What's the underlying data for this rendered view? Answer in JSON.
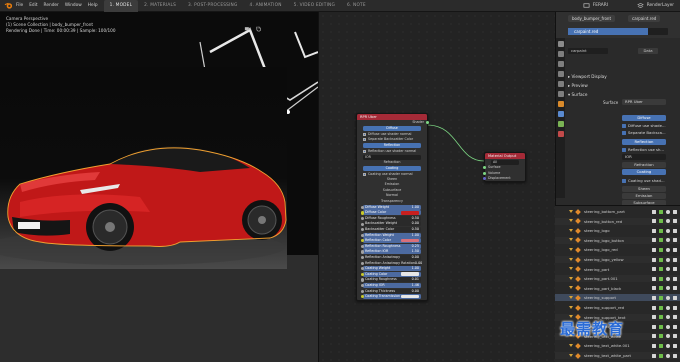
{
  "topbar": {
    "menu": [
      "File",
      "Edit",
      "Render",
      "Window",
      "Help"
    ],
    "tabs": [
      "1. MODEL",
      "2. MATERIALS",
      "3. POST-PROCESSING",
      "4. ANIMATION",
      "5. VIDEO EDITING",
      "6. NOTE"
    ],
    "active_tab_index": 0,
    "scene_name": "FERARI",
    "view_layer": "RenderLayer"
  },
  "viewport": {
    "line1": "Camera Perspective",
    "line2": "(1) Scene Collection | body_bumper_front",
    "line3": "Rendering Done | Time: 00:00:39 | Sample: 100/100"
  },
  "nodes": {
    "main": {
      "title": "RPR Uber",
      "output_label": "Shader",
      "rows": [
        {
          "kind": "btn",
          "label": "Diffuse"
        },
        {
          "kind": "chk",
          "label": "Diffuse use shader normal"
        },
        {
          "kind": "chk",
          "label": "Separate Backscatter Color"
        },
        {
          "kind": "btn",
          "label": "Reflection"
        },
        {
          "kind": "chk",
          "label": "Reflection use shader normal"
        },
        {
          "kind": "sel",
          "label": "IOR"
        },
        {
          "kind": "plain",
          "label": "Refraction"
        },
        {
          "kind": "btn",
          "label": "Coating"
        },
        {
          "kind": "chk",
          "label": "Coating use shader normal"
        },
        {
          "kind": "plain",
          "label": "Sheen"
        },
        {
          "kind": "plain",
          "label": "Emission"
        },
        {
          "kind": "plain",
          "label": "Subsurface"
        },
        {
          "kind": "plain",
          "label": "Normal"
        },
        {
          "kind": "plain",
          "label": "Transparency"
        }
      ],
      "fields": [
        {
          "label": "Diffuse Weight",
          "value": "1.00",
          "style": "blue"
        },
        {
          "label": "Diffuse Color",
          "value": "",
          "style": "red"
        },
        {
          "label": "Diffuse Roughness",
          "value": "0.50",
          "style": "dark"
        },
        {
          "label": "Backscatter Weight",
          "value": "0.00",
          "style": "dark"
        },
        {
          "label": "Backscatter Color",
          "value": "0.50",
          "style": "dark"
        },
        {
          "label": "Reflection Weight",
          "value": "1.00",
          "style": "blue"
        },
        {
          "label": "Reflection Color",
          "value": "",
          "style": "pink"
        },
        {
          "label": "Reflection Roughness",
          "value": "0.25",
          "style": "blue"
        },
        {
          "label": "Reflection IOR",
          "value": "1.50",
          "style": "blue"
        },
        {
          "label": "Reflection Anisotropy",
          "value": "0.00",
          "style": "dark"
        },
        {
          "label": "Reflection Anisotropy Rotation",
          "value": "0.00",
          "style": "dark"
        },
        {
          "label": "Coating Weight",
          "value": "1.00",
          "style": "blue"
        },
        {
          "label": "Coating Color",
          "value": "",
          "style": "white"
        },
        {
          "label": "Coating Roughness",
          "value": "0.01",
          "style": "dark"
        },
        {
          "label": "Coating IOR",
          "value": "1.46",
          "style": "blue"
        },
        {
          "label": "Coating Thickness",
          "value": "0.00",
          "style": "dark"
        },
        {
          "label": "Coating Transmission",
          "value": "",
          "style": "white"
        }
      ]
    },
    "output": {
      "title": "Material Output",
      "selector": "All",
      "sockets": [
        "Surface",
        "Volume",
        "Displacement"
      ]
    }
  },
  "properties": {
    "object_tab": "body_bumper_front",
    "material_tab": "carpaint.red",
    "material_slot": "carpaint.red",
    "material_field": "carpaint",
    "data_label": "Data",
    "viewport_display": "Viewport Display",
    "preview": "Preview",
    "surface": "Surface",
    "surface_label": "Surface",
    "surface_value": "RPR Uber",
    "diffuse": "Diffuse",
    "diffuse_chk": "Diffuse use shade...",
    "sep_chk": "Separate Backsca...",
    "reflection": "Reflection",
    "refl_chk": "Reflection use sh...",
    "ior": "IOR",
    "refraction": "Refraction",
    "coating": "Coating",
    "coat_chk": "Coating use shad...",
    "sheen": "Sheen",
    "emission": "Emission",
    "subsurface": "Subsurface"
  },
  "outliner": {
    "rows": [
      "steering_bottom_part",
      "steering_button_red",
      "steering_logo",
      "steering_logo_button",
      "steering_logo_red",
      "steering_logo_yellow",
      "steering_part",
      "steering_part.001",
      "steering_part_black",
      "steering_support",
      "steering_support_red",
      "steering_support_text",
      "steering_text_black",
      "steering_text_white",
      "steering_text_white.001",
      "steering_text_white_part"
    ]
  },
  "watermark": "最需教育"
}
